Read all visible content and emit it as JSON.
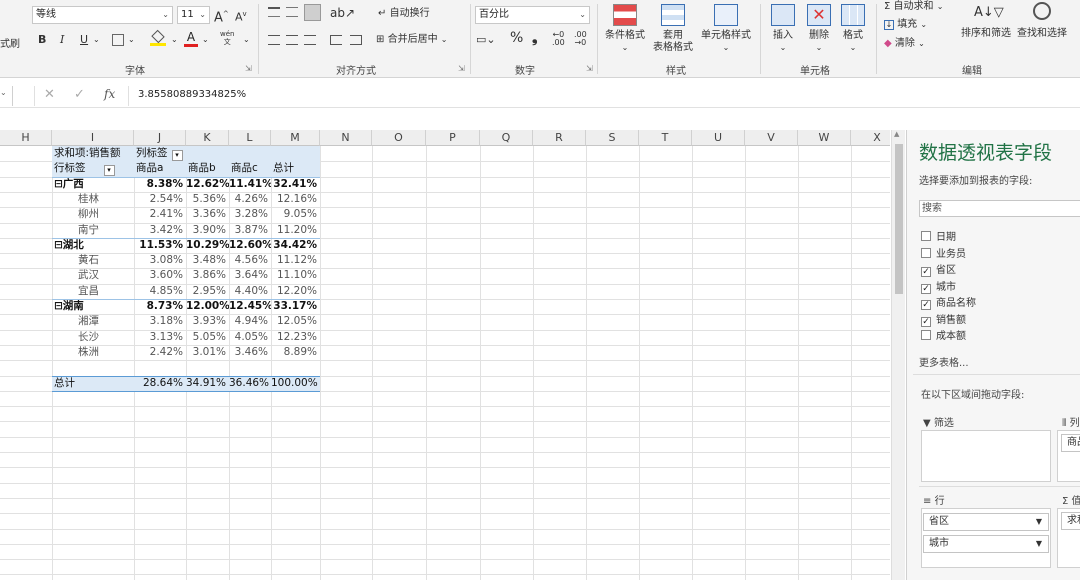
{
  "ribbon": {
    "font_name": "等线",
    "font_size": "11",
    "number_format": "百分比",
    "wrap_text": "自动换行",
    "merge_center": "合并后居中",
    "groups": {
      "font": "字体",
      "alignment": "对齐方式",
      "number": "数字",
      "styles": "样式",
      "cells": "单元格",
      "editing": "编辑"
    },
    "buttons": {
      "conditional_format": "条件格式",
      "table_format_1": "套用",
      "table_format_2": "表格格式",
      "cell_styles": "单元格样式",
      "insert": "插入",
      "delete": "删除",
      "format": "格式",
      "autosum": "自动求和",
      "fill": "填充",
      "clear": "清除",
      "sort_filter": "排序和筛选",
      "find_select": "查找和选择",
      "bold": "B",
      "italic": "I",
      "underline": "U",
      "grow": "A",
      "shrink": "A",
      "percent": "%",
      "comma": "❟",
      "wen": "wén",
      "left_label": "式刷"
    }
  },
  "formula_bar": {
    "value": "3.85580889334825%",
    "fx": "fx"
  },
  "columns": [
    "H",
    "I",
    "J",
    "K",
    "L",
    "M",
    "N",
    "O",
    "P",
    "Q",
    "R",
    "S",
    "T",
    "U",
    "V",
    "W",
    "X"
  ],
  "pivot": {
    "header_value": "求和项:销售额",
    "col_label": "列标签",
    "row_label": "行标签",
    "col_headers": [
      "商品a",
      "商品b",
      "商品c",
      "总计"
    ],
    "rows": [
      {
        "label": "⊟广西",
        "level": 0,
        "values": [
          "8.38%",
          "12.62%",
          "11.41%",
          "32.41%"
        ]
      },
      {
        "label": "桂林",
        "level": 1,
        "values": [
          "2.54%",
          "5.36%",
          "4.26%",
          "12.16%"
        ]
      },
      {
        "label": "柳州",
        "level": 1,
        "values": [
          "2.41%",
          "3.36%",
          "3.28%",
          "9.05%"
        ]
      },
      {
        "label": "南宁",
        "level": 1,
        "values": [
          "3.42%",
          "3.90%",
          "3.87%",
          "11.20%"
        ]
      },
      {
        "label": "⊟湖北",
        "level": 0,
        "values": [
          "11.53%",
          "10.29%",
          "12.60%",
          "34.42%"
        ]
      },
      {
        "label": "黄石",
        "level": 1,
        "values": [
          "3.08%",
          "3.48%",
          "4.56%",
          "11.12%"
        ]
      },
      {
        "label": "武汉",
        "level": 1,
        "values": [
          "3.60%",
          "3.86%",
          "3.64%",
          "11.10%"
        ]
      },
      {
        "label": "宜昌",
        "level": 1,
        "values": [
          "4.85%",
          "2.95%",
          "4.40%",
          "12.20%"
        ]
      },
      {
        "label": "⊟湖南",
        "level": 0,
        "values": [
          "8.73%",
          "12.00%",
          "12.45%",
          "33.17%"
        ]
      },
      {
        "label": "湘潭",
        "level": 1,
        "values": [
          "3.18%",
          "3.93%",
          "4.94%",
          "12.05%"
        ]
      },
      {
        "label": "长沙",
        "level": 1,
        "values": [
          "3.13%",
          "5.05%",
          "4.05%",
          "12.23%"
        ]
      },
      {
        "label": "株洲",
        "level": 1,
        "values": [
          "2.42%",
          "3.01%",
          "3.46%",
          "8.89%"
        ]
      }
    ],
    "total": {
      "label": "总计",
      "values": [
        "28.64%",
        "34.91%",
        "36.46%",
        "100.00%"
      ]
    }
  },
  "pane": {
    "title": "数据透视表字段",
    "subtitle": "选择要添加到报表的字段:",
    "search_placeholder": "搜索",
    "fields": [
      {
        "name": "日期",
        "checked": false
      },
      {
        "name": "业务员",
        "checked": false
      },
      {
        "name": "省区",
        "checked": true
      },
      {
        "name": "城市",
        "checked": true
      },
      {
        "name": "商品名称",
        "checked": true
      },
      {
        "name": "销售额",
        "checked": true
      },
      {
        "name": "成本额",
        "checked": false
      }
    ],
    "more_tables": "更多表格...",
    "drag_hint": "在以下区域间拖动字段:",
    "filter_label": "筛选",
    "columns_label": "列",
    "column_pill": "商品",
    "rows_label": "行",
    "values_label": "Σ 值",
    "row_pills": [
      "省区",
      "城市"
    ],
    "value_pill": "求和"
  },
  "colors": {
    "accent": "#217346",
    "header_band": "#dce9f6"
  }
}
